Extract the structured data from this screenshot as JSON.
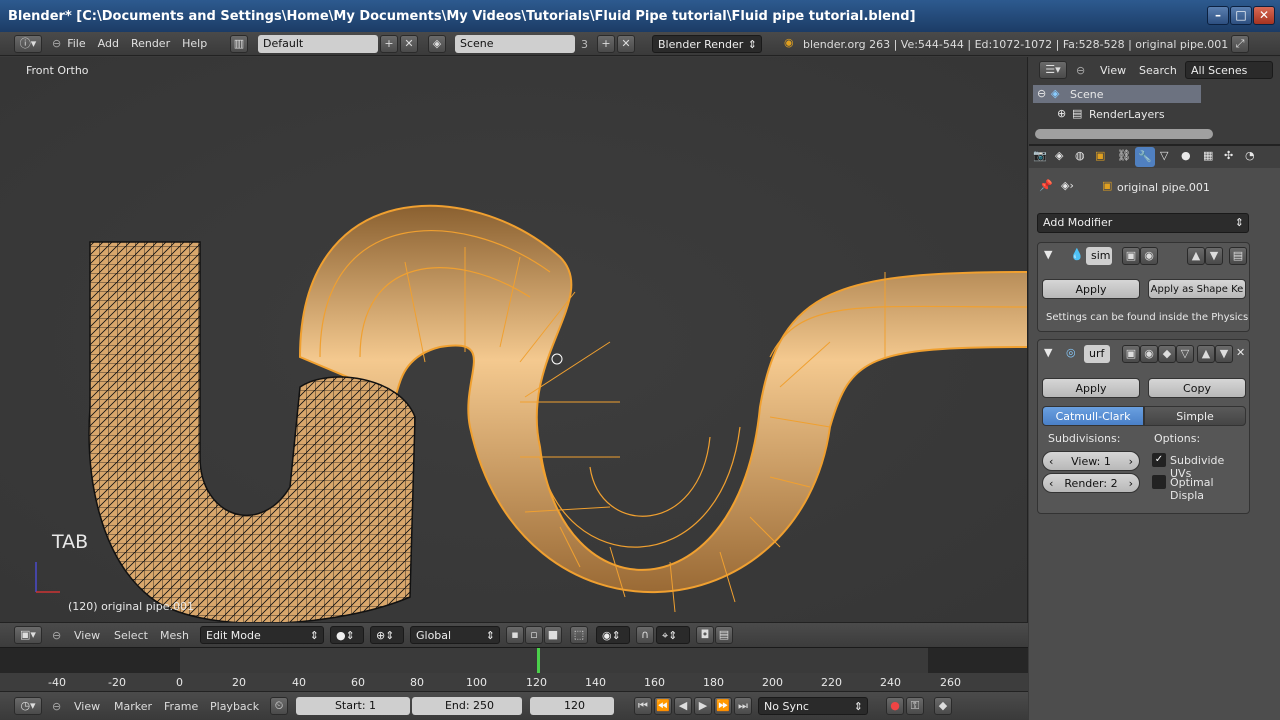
{
  "window": {
    "title": "Blender* [C:\\Documents and Settings\\Home\\My Documents\\My Videos\\Tutorials\\Fluid Pipe tutorial\\Fluid pipe tutorial.blend]"
  },
  "menubar": {
    "menus": [
      "File",
      "Add",
      "Render",
      "Help"
    ],
    "layout": "Default",
    "scene": "Scene",
    "scene_users": "3",
    "engine": "Blender Render",
    "stats": "blender.org 263 | Ve:544-544 | Ed:1072-1072 | Fa:528-528 | original pipe.001"
  },
  "viewport": {
    "view_name": "Front Ortho",
    "overlay_key": "TAB",
    "object_info": "(120) original pipe.001"
  },
  "view_toolbar": {
    "menus": [
      "View",
      "Select",
      "Mesh"
    ],
    "mode": "Edit Mode",
    "orientation": "Global"
  },
  "timeline": {
    "ticks": [
      "-40",
      "-20",
      "0",
      "20",
      "40",
      "60",
      "80",
      "100",
      "120",
      "140",
      "160",
      "180",
      "200",
      "220",
      "240",
      "260"
    ],
    "menus": [
      "View",
      "Marker",
      "Frame",
      "Playback"
    ],
    "start": "Start: 1",
    "end": "End: 250",
    "current": "120",
    "sync": "No Sync"
  },
  "outliner": {
    "menus": [
      "View",
      "Search"
    ],
    "filter": "All Scenes",
    "items": [
      "Scene",
      "RenderLayers"
    ]
  },
  "properties": {
    "object_name": "original pipe.001",
    "add_modifier": "Add Modifier",
    "mod1": {
      "name": "sim",
      "apply": "Apply",
      "apply_shape": "Apply as Shape Ke",
      "note": "Settings can be found inside the Physics"
    },
    "mod2": {
      "name": "urf",
      "apply": "Apply",
      "copy": "Copy",
      "catmull": "Catmull-Clark",
      "simple": "Simple",
      "subdivisions_label": "Subdivisions:",
      "options_label": "Options:",
      "view": "View: 1",
      "render": "Render: 2",
      "subdivide_uvs": "Subdivide UVs",
      "optimal_display": "Optimal Displa"
    }
  }
}
